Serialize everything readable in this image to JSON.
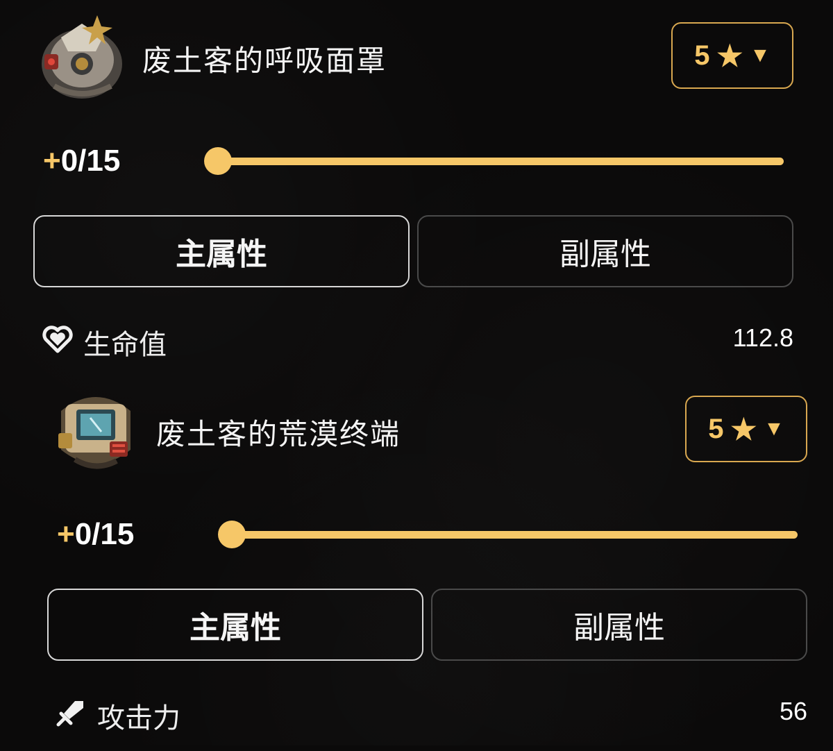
{
  "items": [
    {
      "name": "废土客的呼吸面罩",
      "icon": "breathing-mask-icon",
      "rarity": {
        "value": "5",
        "star": "★",
        "caret": "▼"
      },
      "level": {
        "plus": "+",
        "current_max": "0/15",
        "progress": 0
      },
      "tabs": {
        "main": "主属性",
        "sub": "副属性",
        "selected": "main"
      },
      "stat": {
        "icon": "heart-icon",
        "label": "生命值",
        "value": "112.8"
      }
    },
    {
      "name": "废土客的荒漠终端",
      "icon": "desert-terminal-icon",
      "rarity": {
        "value": "5",
        "star": "★",
        "caret": "▼"
      },
      "level": {
        "plus": "+",
        "current_max": "0/15",
        "progress": 0
      },
      "tabs": {
        "main": "主属性",
        "sub": "副属性",
        "selected": "main"
      },
      "stat": {
        "icon": "sword-icon",
        "label": "攻击力",
        "value": "56"
      }
    }
  ],
  "colors": {
    "accent": "#f6c768",
    "background": "#0b0a0a",
    "active_border": "#d8d8d8",
    "inactive_border": "#4a4a4a"
  }
}
